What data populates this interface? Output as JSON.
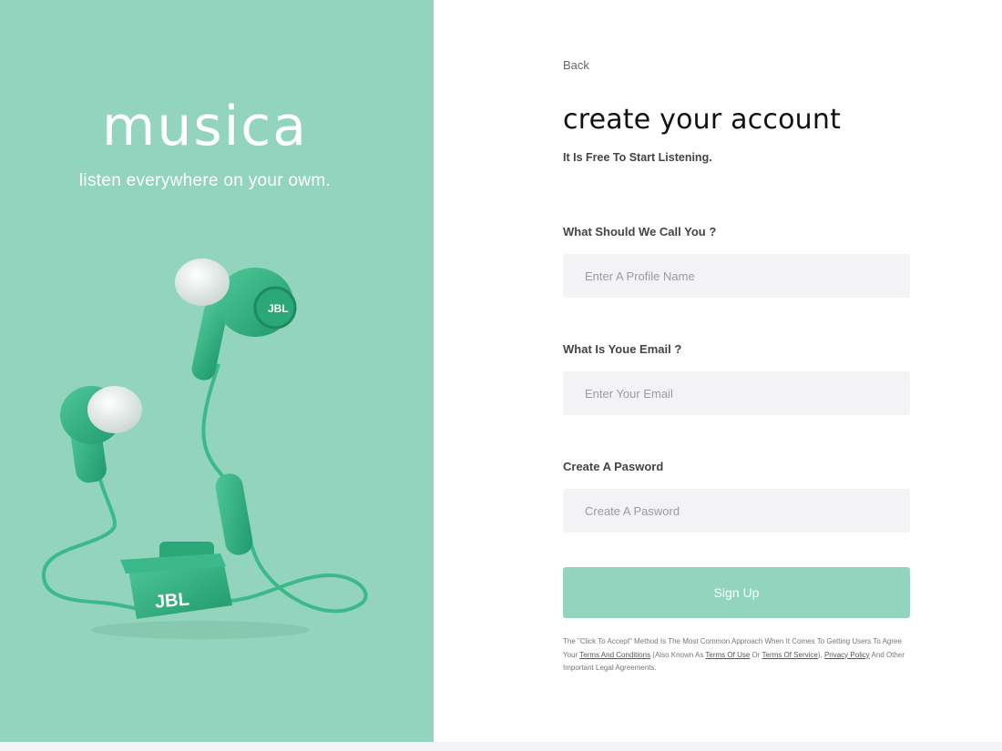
{
  "brand": {
    "logo": "musica",
    "tagline": "listen everywhere on your owm.",
    "accent_color": "#93d4bf",
    "hero_image": "green-jbl-earbuds",
    "hero_image_brand_text": "JBL"
  },
  "form": {
    "back_label": "Back",
    "title": "create your account",
    "subtitle": "It Is Free To Start Listening.",
    "name_label": "What Should We Call You ?",
    "name_placeholder": "Enter A Profile Name",
    "email_label": "What Is Youe Email ?",
    "email_placeholder": "Enter Your Email",
    "password_label": "Create A Pasword",
    "password_placeholder": "Create A Pasword",
    "submit_label": "Sign Up"
  },
  "legal": {
    "text_1": "The \"Click To Accept\" Method Is The Most Common Approach When It Comes To Getting Users To Agree Your ",
    "terms_link": "Terms And Conditions",
    "text_2": " (Also Known As ",
    "terms_of_use_link": "Terms Of Use",
    "text_3": " Or ",
    "terms_of_service_link": "Terms Of Service",
    "text_4": "), ",
    "privacy_link": "Privacy Policy",
    "text_5": " And Other Important Legal Agreements."
  }
}
